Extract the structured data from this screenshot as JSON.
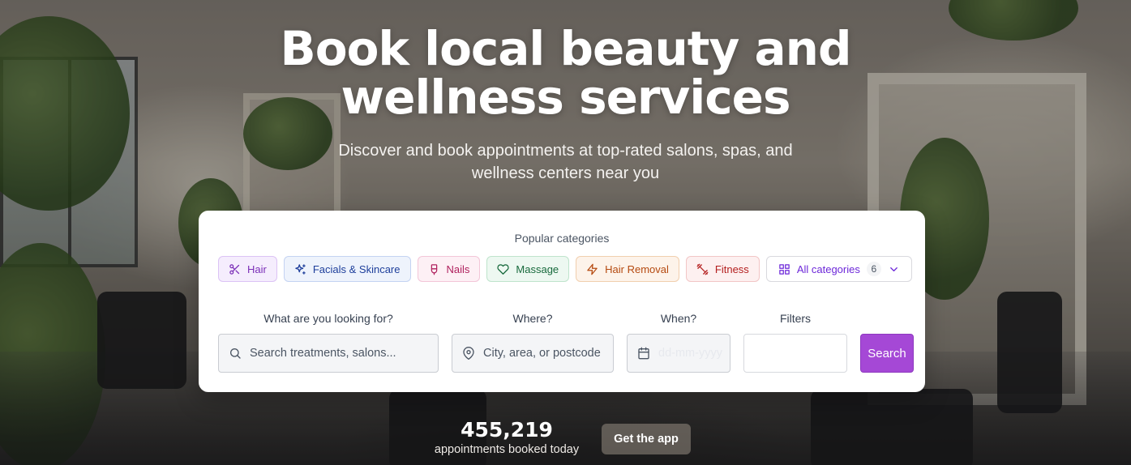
{
  "hero": {
    "title_line1": "Book local beauty and",
    "title_line2": "wellness services",
    "subtitle_line1": "Discover and book appointments at top-rated salons, spas, and",
    "subtitle_line2": "wellness centers near you"
  },
  "categories": {
    "title": "Popular categories",
    "items": [
      {
        "label": "Hair",
        "icon": "scissors-icon"
      },
      {
        "label": "Facials & Skincare",
        "icon": "sparkles-icon"
      },
      {
        "label": "Nails",
        "icon": "nail-polish-icon"
      },
      {
        "label": "Massage",
        "icon": "heart-icon"
      },
      {
        "label": "Hair Removal",
        "icon": "zap-icon"
      },
      {
        "label": "Fitness",
        "icon": "dumbbell-icon"
      }
    ],
    "all": {
      "label": "All categories",
      "count": "6",
      "icon": "grid-icon"
    }
  },
  "search": {
    "what": {
      "label": "What are you looking for?",
      "placeholder": "Search treatments, salons..."
    },
    "where": {
      "label": "Where?",
      "placeholder": "City, area, or postcode"
    },
    "when": {
      "label": "When?",
      "placeholder": "dd-mm-yyyy"
    },
    "filters": {
      "label": "Filters"
    },
    "button": "Search"
  },
  "stats": {
    "count": "455,219",
    "label": "appointments booked today"
  },
  "app_button": "Get the app",
  "colors": {
    "accent": "#a548d6",
    "hair": "#7b2fb8",
    "facials": "#1e3f9b",
    "nails": "#b0215e",
    "massage": "#186a3d",
    "hair_removal": "#b54a10",
    "fitness": "#b41f1f"
  }
}
